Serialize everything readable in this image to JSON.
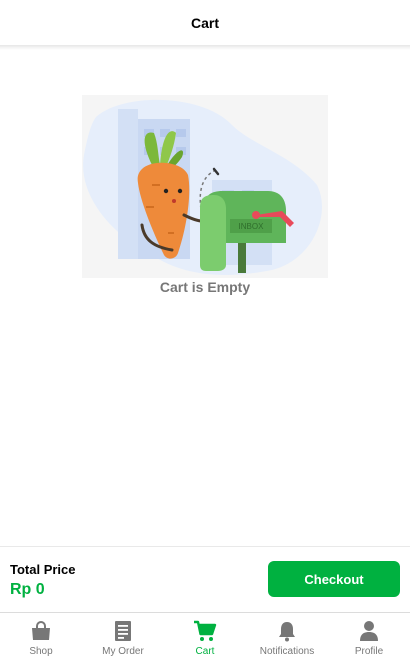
{
  "header": {
    "title": "Cart"
  },
  "empty_state": {
    "message": "Cart is Empty",
    "illustration_text": "INBOX"
  },
  "footer": {
    "total_label": "Total Price",
    "total_value": "Rp 0",
    "checkout_label": "Checkout"
  },
  "tabs": [
    {
      "label": "Shop",
      "icon": "shopping-bag-icon",
      "active": false
    },
    {
      "label": "My Order",
      "icon": "receipt-icon",
      "active": false
    },
    {
      "label": "Cart",
      "icon": "cart-icon",
      "active": true
    },
    {
      "label": "Notifications",
      "icon": "bell-icon",
      "active": false
    },
    {
      "label": "Profile",
      "icon": "person-icon",
      "active": false
    }
  ],
  "colors": {
    "accent": "#00b140",
    "inactive": "#777777",
    "empty_text": "#777777"
  }
}
